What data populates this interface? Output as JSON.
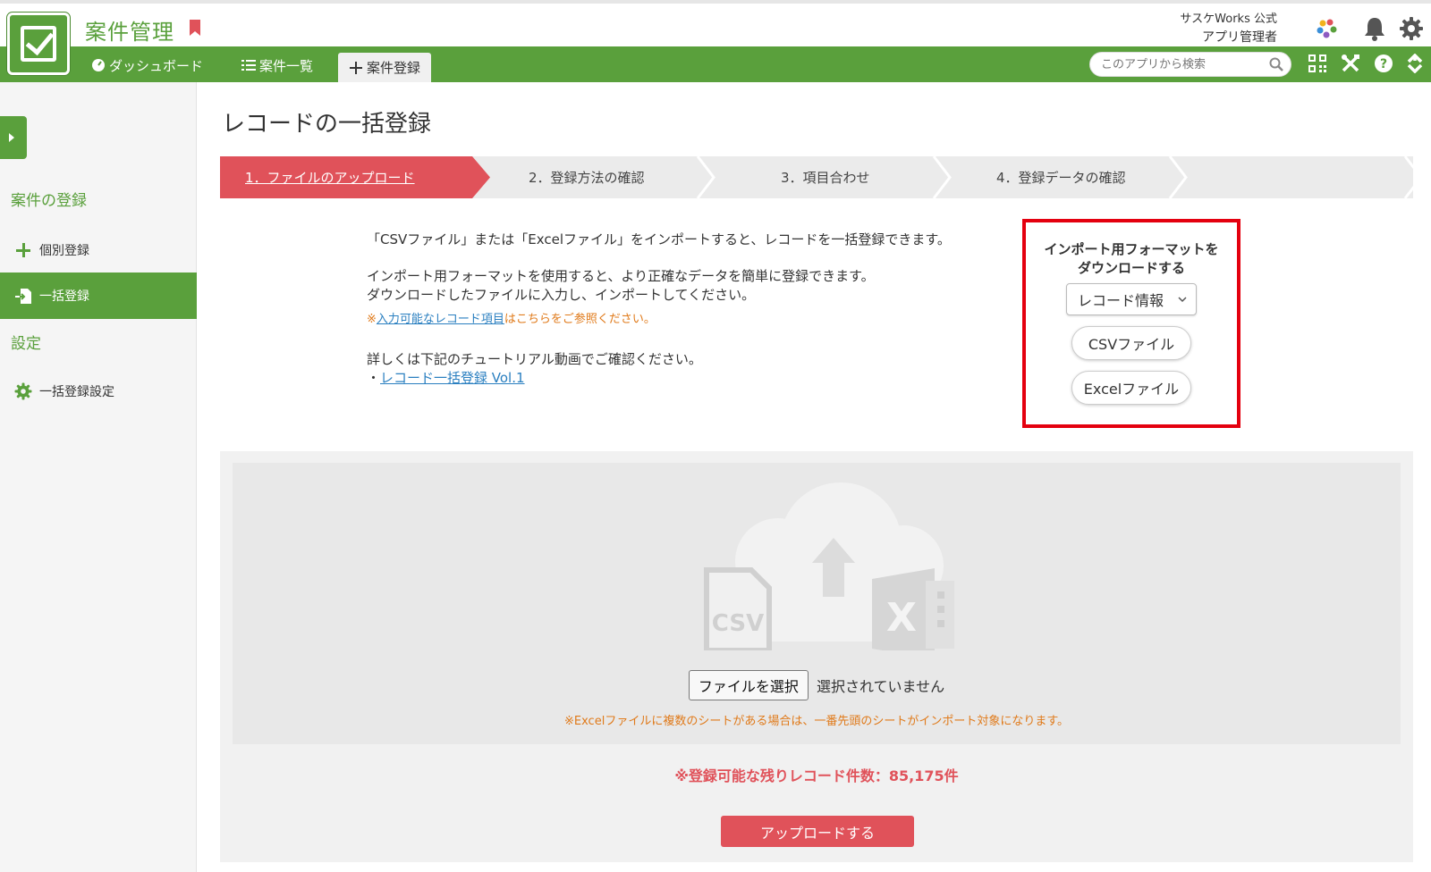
{
  "app": {
    "title": "案件管理",
    "org": "サスケWorks 公式",
    "user": "アプリ管理者"
  },
  "nav": {
    "dashboard": "ダッシュボード",
    "list": "案件一覧",
    "register": "案件登録",
    "search_placeholder": "このアプリから検索"
  },
  "sidebar": {
    "section1": "案件の登録",
    "item_single": "個別登録",
    "item_bulk": "一括登録",
    "section2": "設定",
    "item_settings": "一括登録設定"
  },
  "page": {
    "title": "レコードの一括登録"
  },
  "steps": [
    "1．ファイルのアップロード",
    "2．登録方法の確認",
    "3．項目合わせ",
    "4．登録データの確認"
  ],
  "intro": {
    "p1": "「CSVファイル」または「Excelファイル」をインポートすると、レコードを一括登録できます。",
    "p2_line1": "インポート用フォーマットを使用すると、より正確なデータを簡単に登録できます。",
    "p2_line2": "ダウンロードしたファイルに入力し、インポートしてください。",
    "note_prefix": "※",
    "note_link": "入力可能なレコード項目",
    "note_suffix": "はこちらをご参照ください。",
    "p3": "詳しくは下記のチュートリアル動画でご確認ください。",
    "bullet": "・",
    "video_link": "レコード一括登録 Vol.1"
  },
  "format": {
    "title_line1": "インポート用フォーマットを",
    "title_line2": "ダウンロードする",
    "select_value": "レコード情報",
    "csv_button": "CSVファイル",
    "excel_button": "Excelファイル"
  },
  "upload": {
    "choose_file": "ファイルを選択",
    "no_file": "選択されていません",
    "excel_note": "※Excelファイルに複数のシートがある場合は、一番先頭のシートがインポート対象になります。",
    "remaining": "※登録可能な残りレコード件数：85,175件",
    "upload_button": "アップロードする",
    "csv_label": "CSV",
    "excel_label": "X"
  },
  "colors": {
    "brand_green": "#5aa03c",
    "accent_red": "#e0525a",
    "highlight_border": "#e4000f",
    "note_orange": "#e07a1a"
  }
}
